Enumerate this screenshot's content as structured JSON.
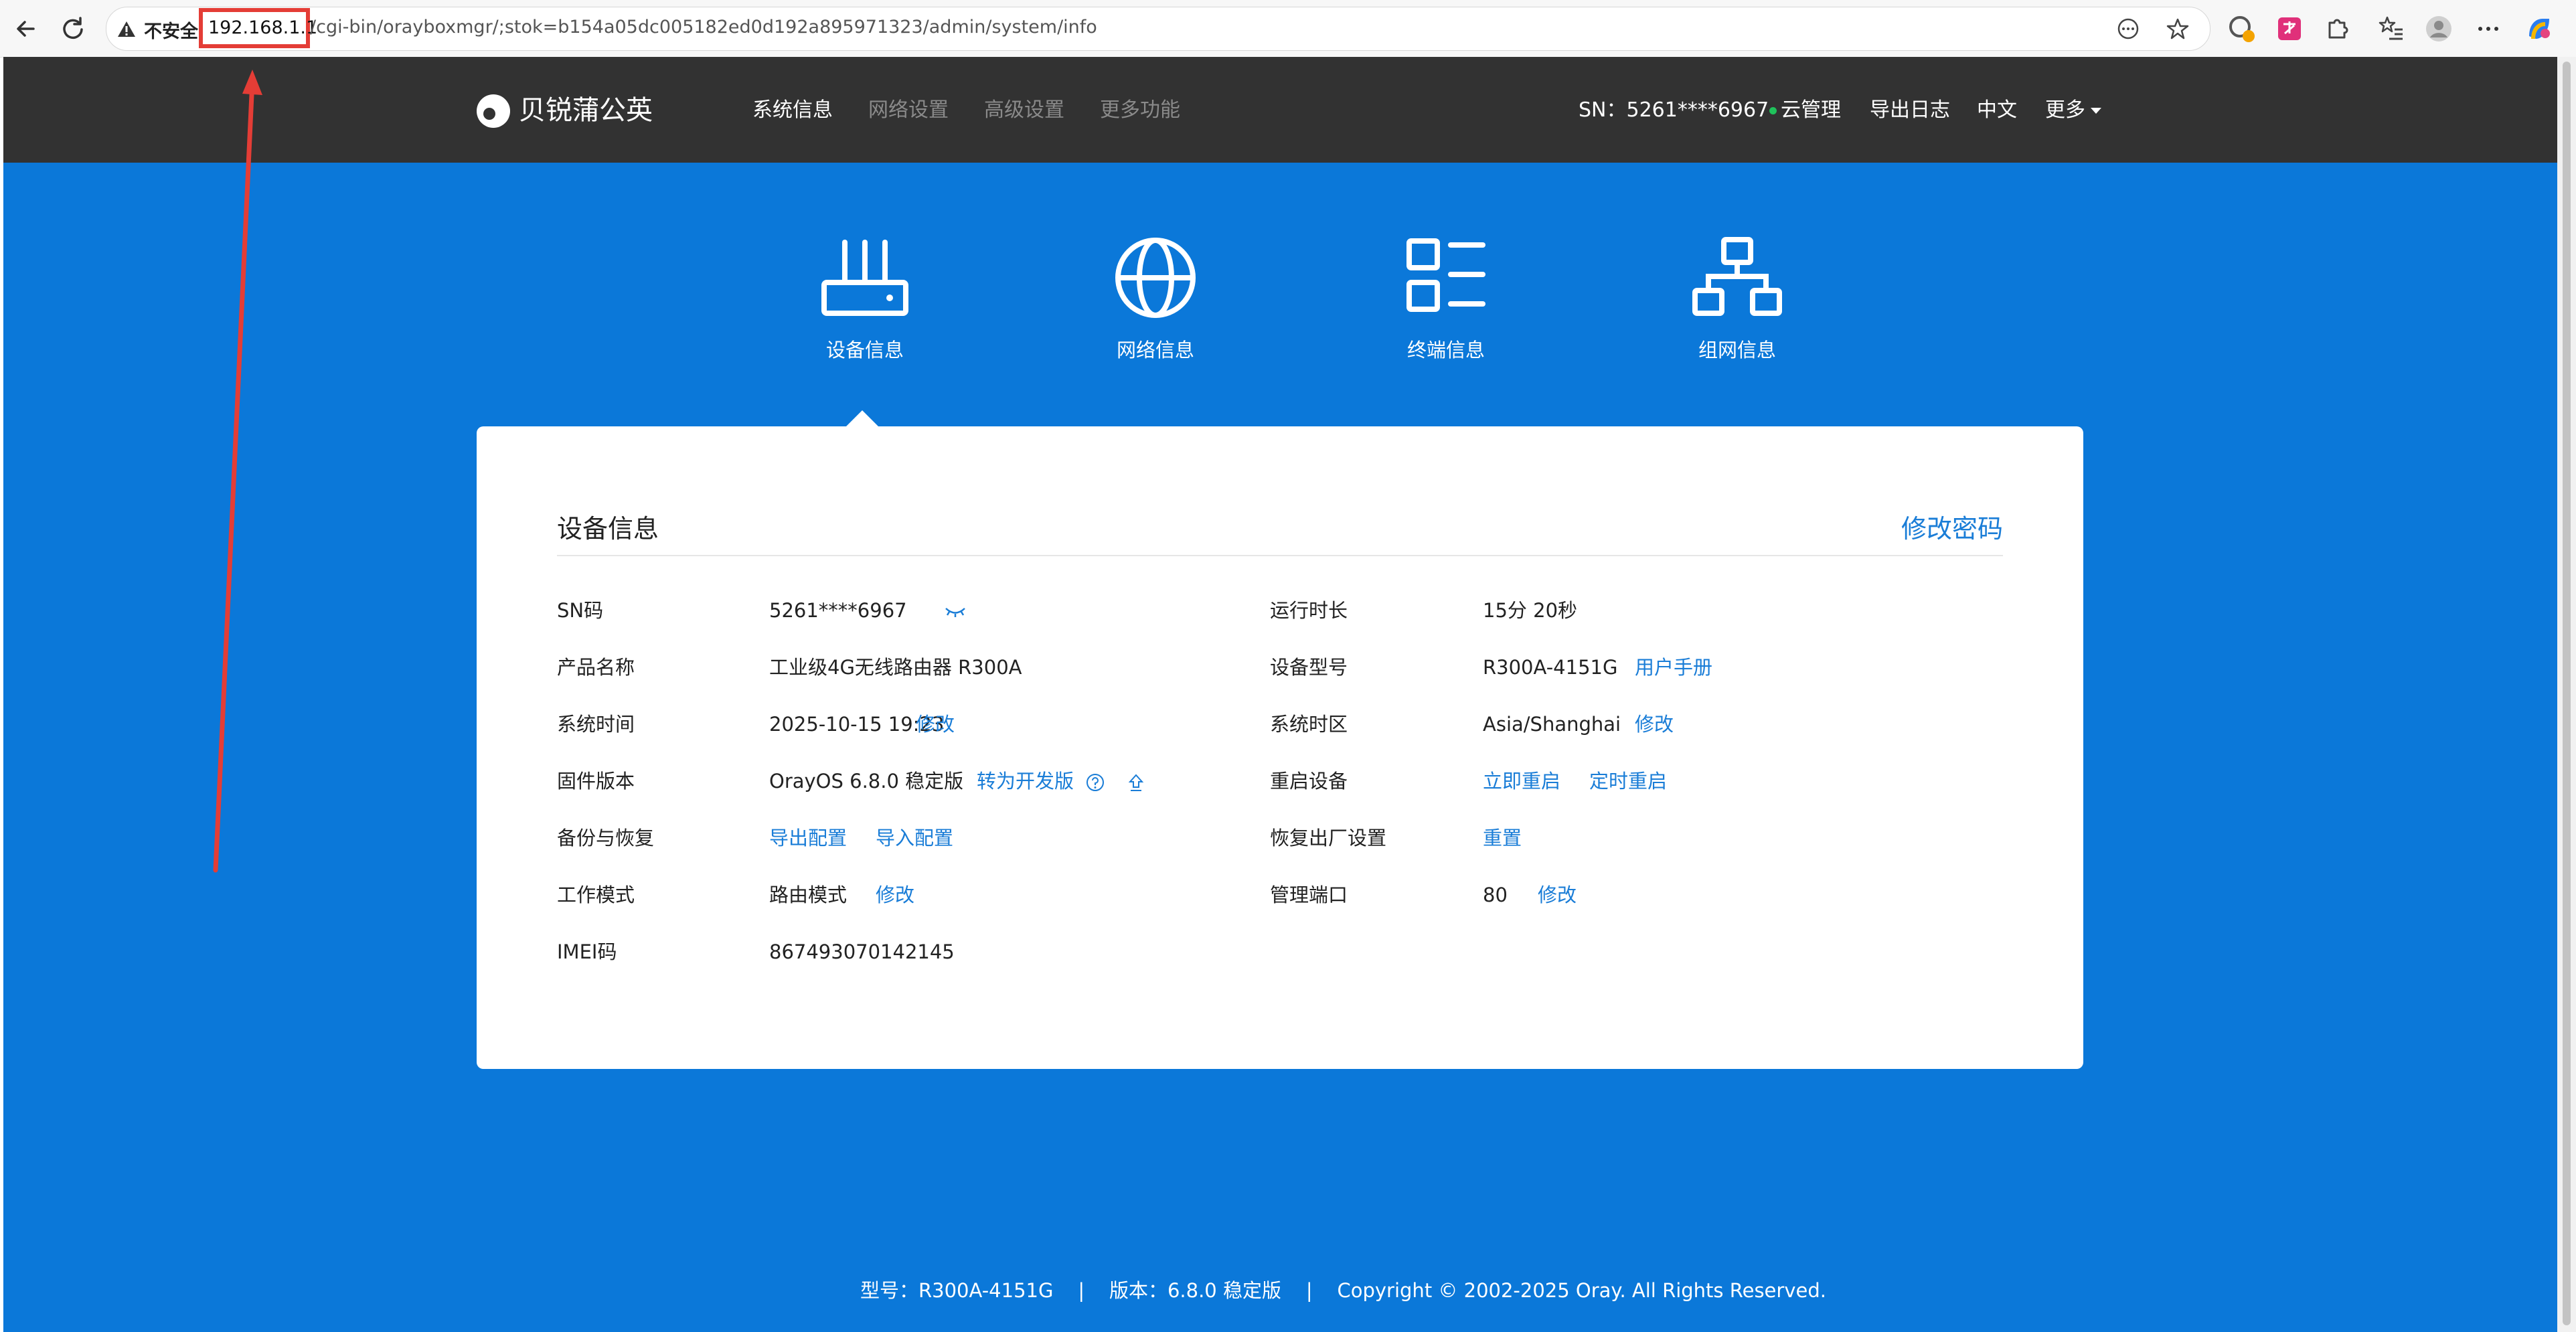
{
  "browser": {
    "insecure_label": "不安全",
    "url_host": "192.168.1.1",
    "url_path": "/cgi-bin/orayboxmgr/;stok=b154a05dc005182ed0d192a895971323/admin/system/info"
  },
  "header": {
    "brand": "贝锐蒲公英",
    "nav": [
      "系统信息",
      "网络设置",
      "高级设置",
      "更多功能"
    ],
    "sn": "SN：5261****6967",
    "cloud": "云管理",
    "export_log": "导出日志",
    "language": "中文",
    "more": "更多"
  },
  "info_tabs": [
    "设备信息",
    "网络信息",
    "终端信息",
    "组网信息"
  ],
  "card": {
    "title": "设备信息",
    "change_password": "修改密码",
    "left_rows": [
      {
        "label": "SN码",
        "value": "5261****6967"
      },
      {
        "label": "产品名称",
        "value": "工业级4G无线路由器 R300A"
      },
      {
        "label": "系统时间",
        "value": "2025-10-15 19:23",
        "link": "修改"
      },
      {
        "label": "固件版本",
        "value": "OrayOS 6.8.0 稳定版",
        "link": "转为开发版"
      },
      {
        "label": "备份与恢复",
        "link": "导出配置",
        "link2": "导入配置"
      },
      {
        "label": "工作模式",
        "value": "路由模式",
        "link": "修改"
      },
      {
        "label": "IMEI码",
        "value": "867493070142145"
      }
    ],
    "right_rows": [
      {
        "label": "运行时长",
        "value": "15分 20秒"
      },
      {
        "label": "设备型号",
        "value": "R300A-4151G",
        "link": "用户手册"
      },
      {
        "label": "系统时区",
        "value": "Asia/Shanghai",
        "link": "修改"
      },
      {
        "label": "重启设备",
        "link": "立即重启",
        "link2": "定时重启"
      },
      {
        "label": "恢复出厂设置",
        "link": "重置"
      },
      {
        "label": "管理端口",
        "value": "80",
        "link": "修改"
      }
    ]
  },
  "footer": "型号：R300A-4151G    |    版本：6.8.0 稳定版    |    Copyright © 2002-2025 Oray. All Rights Reserved.",
  "colors": {
    "header_bg": "#323232",
    "body_bg": "#0b78d9",
    "link": "#1a7dd7",
    "highlight_box": "#e43d36"
  }
}
